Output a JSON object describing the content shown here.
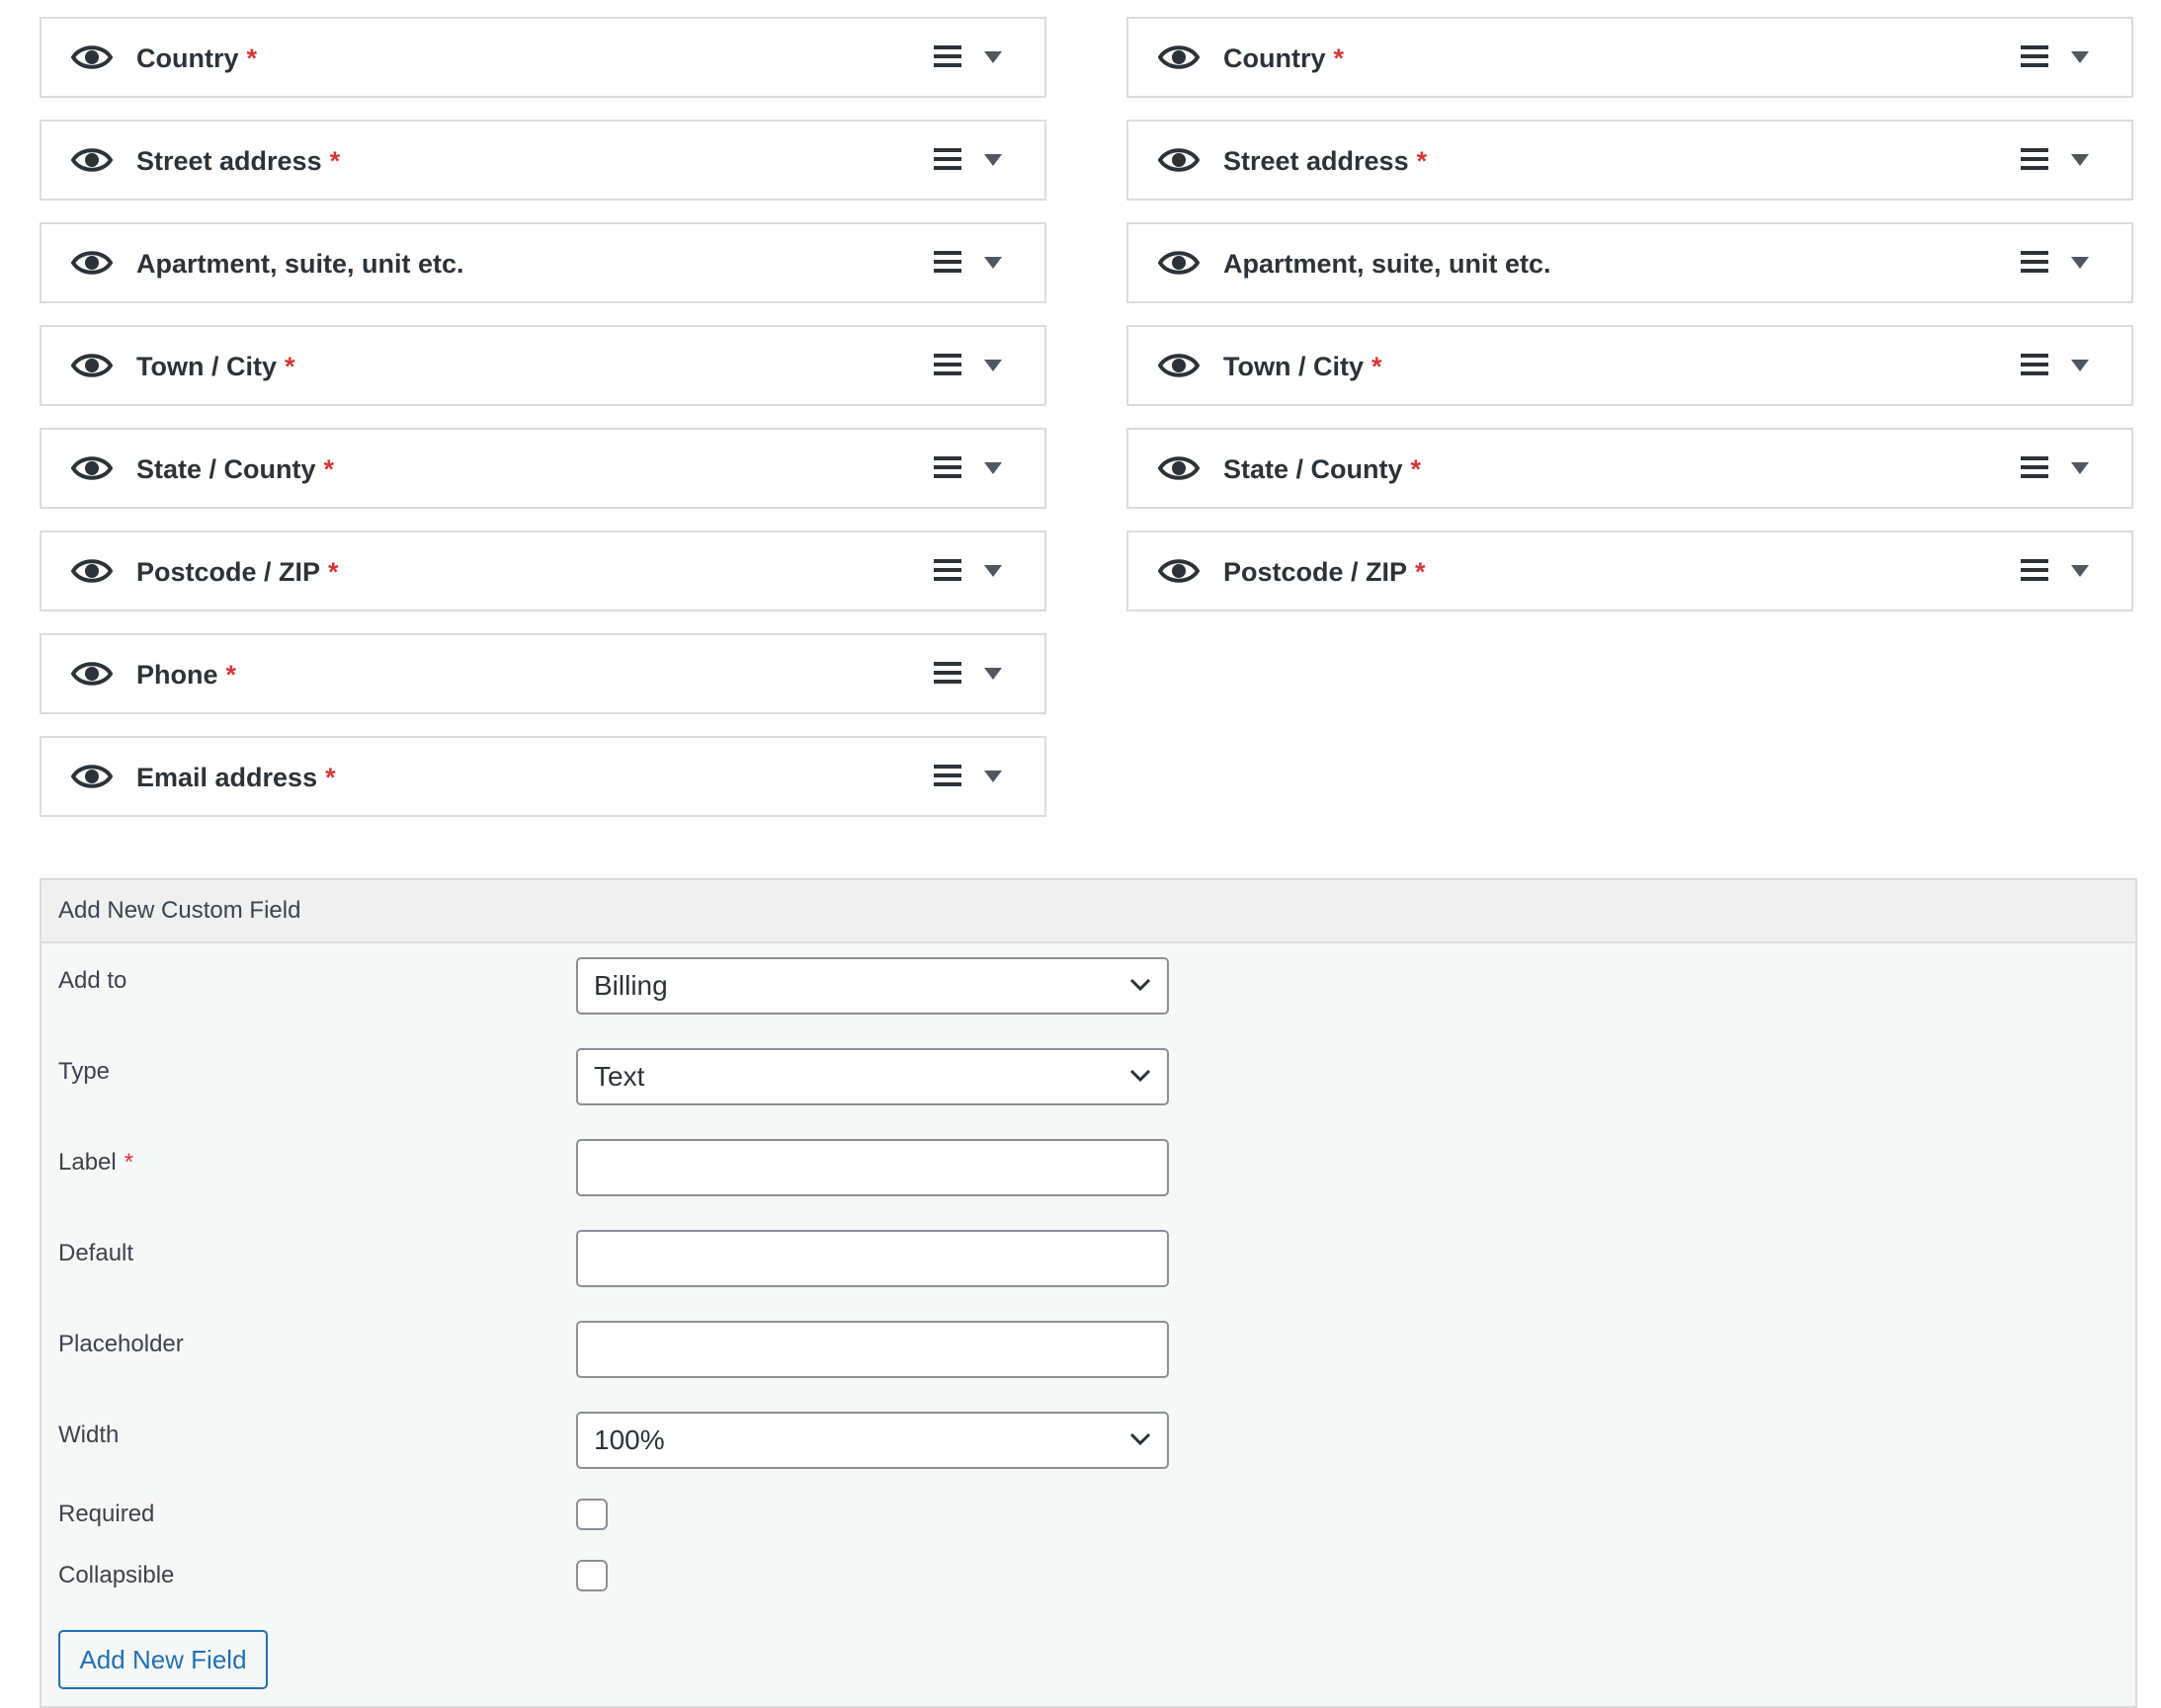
{
  "billing_fields": [
    {
      "label": "Country",
      "required": true
    },
    {
      "label": "Street address",
      "required": true
    },
    {
      "label": "Apartment, suite, unit etc.",
      "required": false
    },
    {
      "label": "Town / City",
      "required": true
    },
    {
      "label": "State / County",
      "required": true
    },
    {
      "label": "Postcode / ZIP",
      "required": true
    },
    {
      "label": "Phone",
      "required": true
    },
    {
      "label": "Email address",
      "required": true
    }
  ],
  "shipping_fields": [
    {
      "label": "Country",
      "required": true
    },
    {
      "label": "Street address",
      "required": true
    },
    {
      "label": "Apartment, suite, unit etc.",
      "required": false
    },
    {
      "label": "Town / City",
      "required": true
    },
    {
      "label": "State / County",
      "required": true
    },
    {
      "label": "Postcode / ZIP",
      "required": true
    }
  ],
  "required_marker": "*",
  "custom_field": {
    "title": "Add New Custom Field",
    "add_to": {
      "label": "Add to",
      "value": "Billing"
    },
    "type": {
      "label": "Type",
      "value": "Text"
    },
    "label_field": {
      "label": "Label",
      "value": ""
    },
    "default_field": {
      "label": "Default",
      "value": ""
    },
    "placeholder_field": {
      "label": "Placeholder",
      "value": ""
    },
    "width": {
      "label": "Width",
      "value": "100%"
    },
    "required": {
      "label": "Required",
      "checked": false
    },
    "collapsible": {
      "label": "Collapsible",
      "checked": false
    },
    "submit_label": "Add New Field"
  },
  "colors": {
    "required": "#d63638",
    "accent": "#2271b1",
    "border": "#dcdcde"
  },
  "icons": [
    "eye-icon",
    "hamburger-menu-icon",
    "caret-down-icon",
    "chevron-down-icon"
  ]
}
